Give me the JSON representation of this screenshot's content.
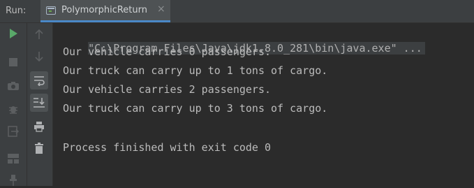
{
  "toolwindow": {
    "run_label": "Run:",
    "tab": {
      "label": "PolymorphicReturn",
      "close": "×"
    }
  },
  "console": {
    "command": "\"C:\\Program Files\\Java\\jdk1.8.0_281\\bin\\java.exe\" ...",
    "lines": [
      "Our vehicle carries 0 passengers.",
      "Our truck can carry up to 1 tons of cargo.",
      "Our vehicle carries 2 passengers.",
      "Our truck can carry up to 3 tons of cargo.",
      "",
      "Process finished with exit code 0"
    ]
  },
  "colors": {
    "run_green": "#59a869",
    "background": "#2b2b2b",
    "panel": "#3c3f41",
    "accent_blue": "#4a88c7"
  },
  "icons": [
    "rerun-icon",
    "stop-icon",
    "camera-icon",
    "debug-icon",
    "exit-icon",
    "layout-icon",
    "pin-icon",
    "up-arrow-icon",
    "down-arrow-icon",
    "soft-wrap-icon",
    "scroll-to-end-icon",
    "print-icon",
    "trash-icon"
  ]
}
